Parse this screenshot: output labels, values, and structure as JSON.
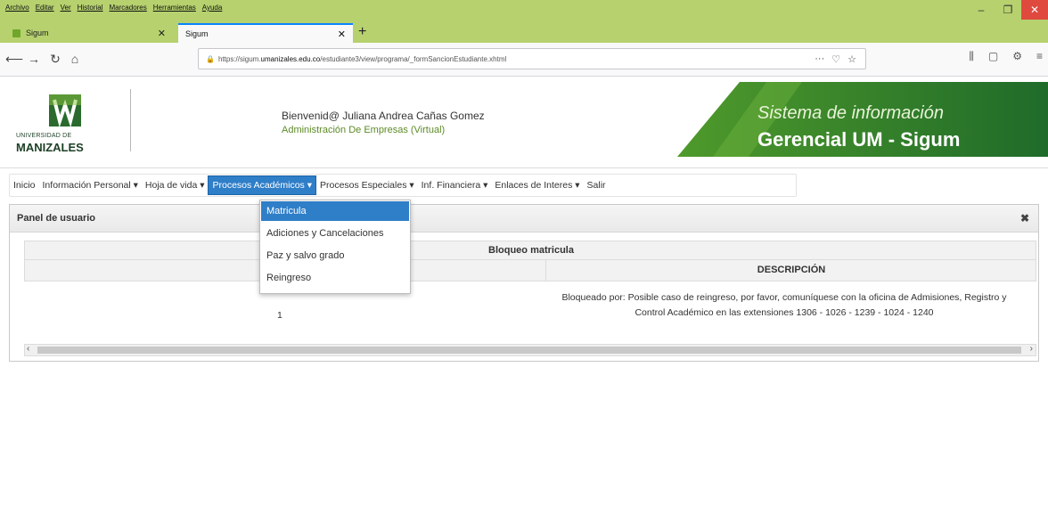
{
  "browser": {
    "menu": [
      "Archivo",
      "Editar",
      "Ver",
      "Historial",
      "Marcadores",
      "Herramientas",
      "Ayuda"
    ],
    "tabs": [
      {
        "label": "Sigum"
      },
      {
        "label": "Sigum"
      }
    ],
    "url": {
      "prefix": "https://sigum.",
      "host": "umanizales.edu.co",
      "path": "/estudiante3/view/programa/_formSancionEstudiante.xhtml"
    }
  },
  "header": {
    "logo_line1": "UNIVERSIDAD DE",
    "logo_line2": "MANIZALES",
    "welcome": "Bienvenid@ Juliana Andrea Cañas Gomez",
    "program": "Administración De Empresas (Virtual)",
    "banner_line1": "Sistema de información",
    "banner_line2": "Gerencial UM - Sigum"
  },
  "menu": [
    {
      "label": "Inicio"
    },
    {
      "label": "Información Personal ▾"
    },
    {
      "label": "Hoja de vida ▾"
    },
    {
      "label": "Procesos Académicos ▾"
    },
    {
      "label": "Procesos Especiales ▾"
    },
    {
      "label": "Inf. Financiera ▾"
    },
    {
      "label": "Enlaces de Interes ▾"
    },
    {
      "label": "Salir"
    }
  ],
  "dropdown": [
    "Matricula",
    "Adiciones y Cancelaciones",
    "Paz y salvo grado",
    "Reingreso"
  ],
  "panel": {
    "title": "Panel de usuario",
    "close": "✖",
    "table_caption": "Bloqueo matricula",
    "col_desc": "DESCRIPCIÓN",
    "row_num": "1",
    "row_desc": "Bloqueado por: Posible caso de reingreso, por favor, comuníquese con la oficina de Admisiones, Registro y Control Académico en las extensiones 1306 - 1026 - 1239 - 1024 - 1240"
  },
  "colors": {
    "chrome": "#b6d16e",
    "accent": "#2f7ec8",
    "brand_green": "#5c8b25"
  }
}
